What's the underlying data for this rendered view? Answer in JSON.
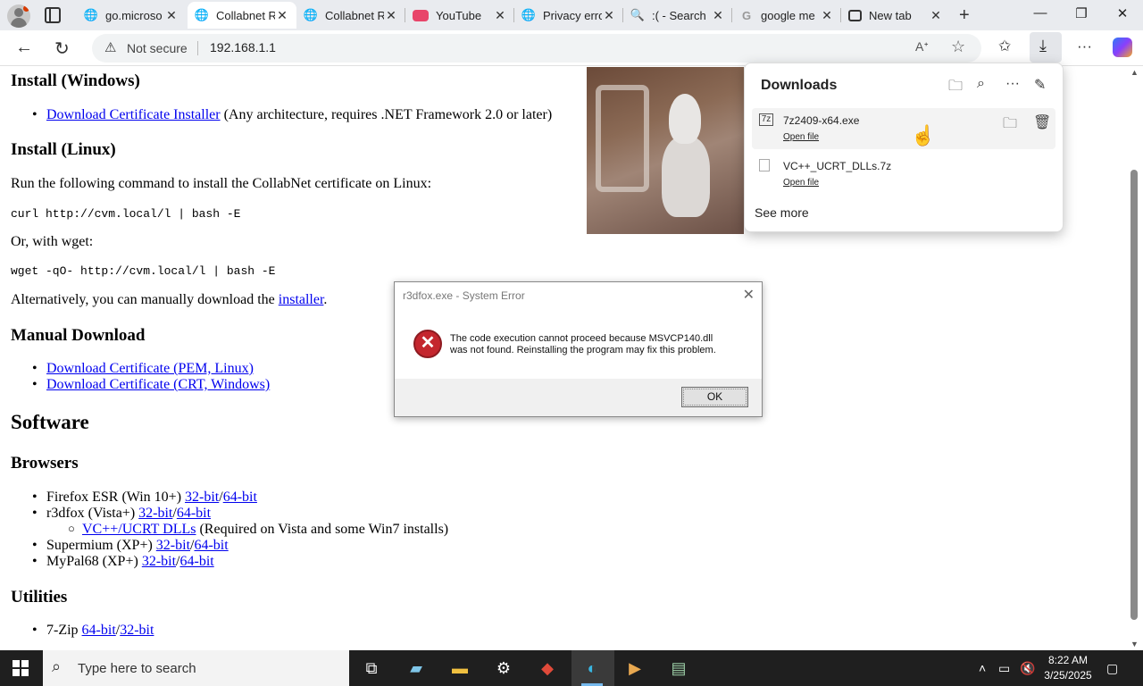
{
  "tabs": [
    {
      "label": "go.microso",
      "icon": "globe-icon"
    },
    {
      "label": "Collabnet R",
      "icon": "globe-icon",
      "active": true
    },
    {
      "label": "Collabnet R",
      "icon": "globe-icon"
    },
    {
      "label": "YouTube",
      "icon": "youtube-icon"
    },
    {
      "label": "Privacy erro",
      "icon": "globe-icon"
    },
    {
      "label": ":( - Search",
      "icon": "search-icon"
    },
    {
      "label": "google me",
      "icon": "google-icon"
    },
    {
      "label": "New tab",
      "icon": "newtab-icon"
    }
  ],
  "address": {
    "security_label": "Not secure",
    "url": "192.168.1.1"
  },
  "page": {
    "install_windows_heading": "Install (Windows)",
    "cert_installer_link": "Download Certificate Installer",
    "cert_installer_note": " (Any architecture, requires .NET Framework 2.0 or later)",
    "install_linux_heading": "Install (Linux)",
    "linux_intro": "Run the following command to install the CollabNet certificate on Linux:",
    "curl_cmd": "curl http://cvm.local/l | bash -E",
    "wget_intro": "Or, with wget:",
    "wget_cmd": "wget -qO- http://cvm.local/l | bash -E",
    "manual_text": "Alternatively, you can manually download the ",
    "installer_link": "installer",
    "manual_text_end": ".",
    "manual_heading": "Manual Download",
    "pem_link": "Download Certificate (PEM, Linux)",
    "crt_link": "Download Certificate (CRT, Windows)",
    "software_heading": "Software",
    "browsers_heading": "Browsers",
    "browsers": {
      "firefox": "Firefox ESR (Win 10+) ",
      "r3dfox": "r3dfox (Vista+) ",
      "vcpp_link": "VC++/UCRT DLLs",
      "vcpp_note": " (Required on Vista and some Win7 installs)",
      "supermium": "Supermium (XP+) ",
      "mypal": "MyPal68 (XP+) ",
      "bit32": "32-bit",
      "bit64": "64-bit",
      "slash": "/"
    },
    "utilities_heading": "Utilities",
    "zip_label": "7-Zip "
  },
  "downloads": {
    "title": "Downloads",
    "items": [
      {
        "name": "7z2409-x64.exe",
        "action": "Open file",
        "icon_text": "7z"
      },
      {
        "name": "VC++_UCRT_DLLs.7z",
        "action": "Open file"
      }
    ],
    "see_more": "See more"
  },
  "dialog": {
    "title": "r3dfox.exe - System Error",
    "line1": "The code execution cannot proceed because MSVCP140.dll",
    "line2": "was not found. Reinstalling the program may fix this problem.",
    "ok": "OK"
  },
  "taskbar": {
    "search_placeholder": "Type here to search",
    "time": "8:22 AM",
    "date": "3/25/2025"
  }
}
